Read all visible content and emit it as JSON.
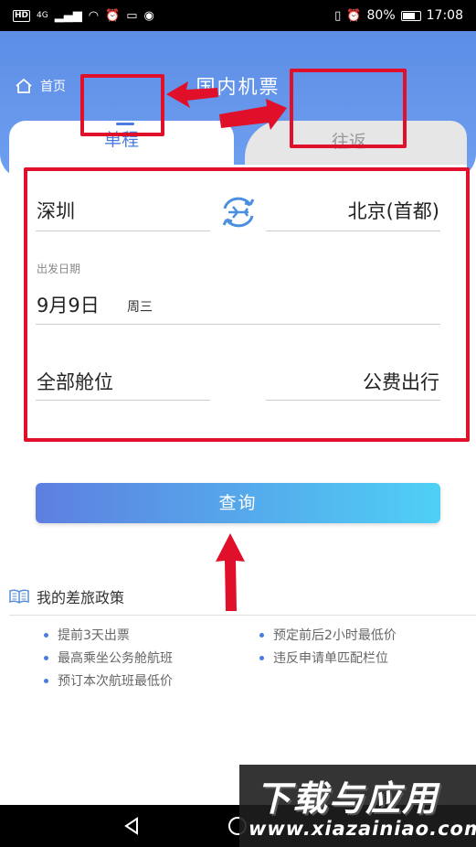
{
  "status_bar": {
    "network": "HD",
    "signal": "4G",
    "battery": "80%",
    "battery_level": 0.8,
    "time": "17:08"
  },
  "header": {
    "home_label": "首页",
    "title": "国内机票"
  },
  "tabs": {
    "one_way": "单程",
    "round_trip": "往返",
    "active": "one_way"
  },
  "form": {
    "from_city": "深圳",
    "to_city": "北京(首都)",
    "date_label": "出发日期",
    "date": "9月9日",
    "weekday": "周三",
    "cabin": "全部舱位",
    "travel_type": "公费出行"
  },
  "search_button": "查询",
  "policy": {
    "title": "我的差旅政策",
    "items": [
      "提前3天出票",
      "预定前后2小时最低价",
      "最高乘坐公务舱航班",
      "违反申请单匹配栏位",
      "预订本次航班最低价"
    ]
  },
  "watermark": {
    "text": "下载与应用",
    "url": "www.xiazainiao.com"
  },
  "colors": {
    "header_blue": "#5c8ee6",
    "accent": "#4a7be0",
    "annotation_red": "#e0102a"
  }
}
